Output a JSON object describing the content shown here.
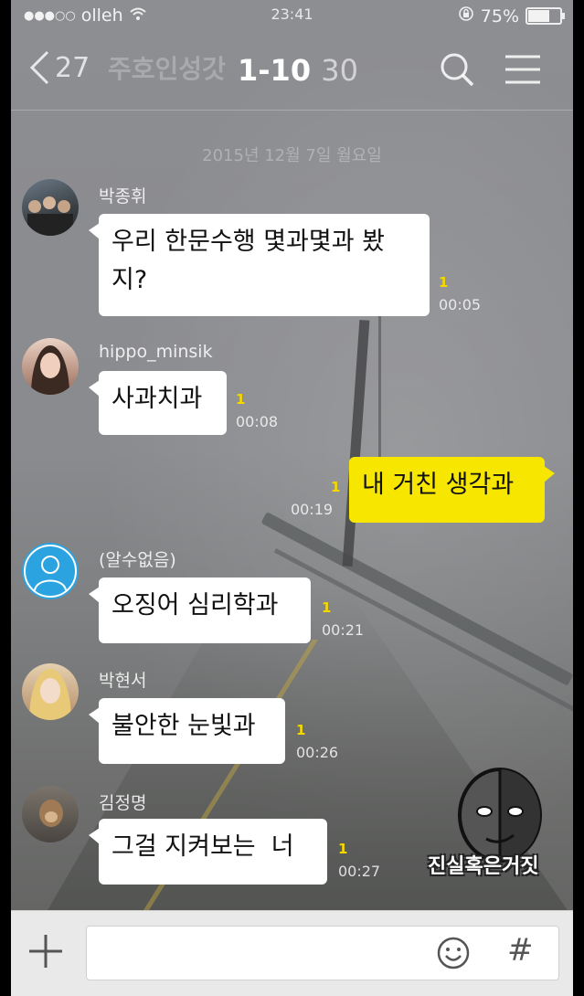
{
  "status_bar": {
    "carrier": "olleh",
    "signal_dots": "●●●○○",
    "time": "23:41",
    "battery": "75%",
    "battery_level": 0.75
  },
  "header": {
    "back_count": "27",
    "chat_title": "주호인성갓",
    "member_label": "1-10",
    "member_total": "30"
  },
  "date_divider": "2015년 12월 7일 월요일",
  "messages": [
    {
      "sender": "박종휘",
      "text": "우리 한문수행 몇과몇과 봤\n지?",
      "unread": "1",
      "time": "00:05",
      "mine": false
    },
    {
      "sender": "hippo_minsik",
      "text": "사과치과",
      "unread": "1",
      "time": "00:08",
      "mine": false
    },
    {
      "sender": "",
      "text": "내 거친 생각과",
      "unread": "1",
      "time": "00:19",
      "mine": true
    },
    {
      "sender": "(알수없음)",
      "text": "오징어 심리학과",
      "unread": "1",
      "time": "00:21",
      "mine": false
    },
    {
      "sender": "박현서",
      "text": "불안한 눈빛과",
      "unread": "1",
      "time": "00:26",
      "mine": false
    },
    {
      "sender": "김정명",
      "text": "그걸 지켜보는  너",
      "unread": "1",
      "time": "00:27",
      "mine": false
    }
  ],
  "watermark": "진실혹은거짓",
  "input_bar": {
    "placeholder": "",
    "hash_label": "#"
  },
  "colors": {
    "my_bubble": "#f6e600",
    "unread_count": "#f5d800"
  }
}
